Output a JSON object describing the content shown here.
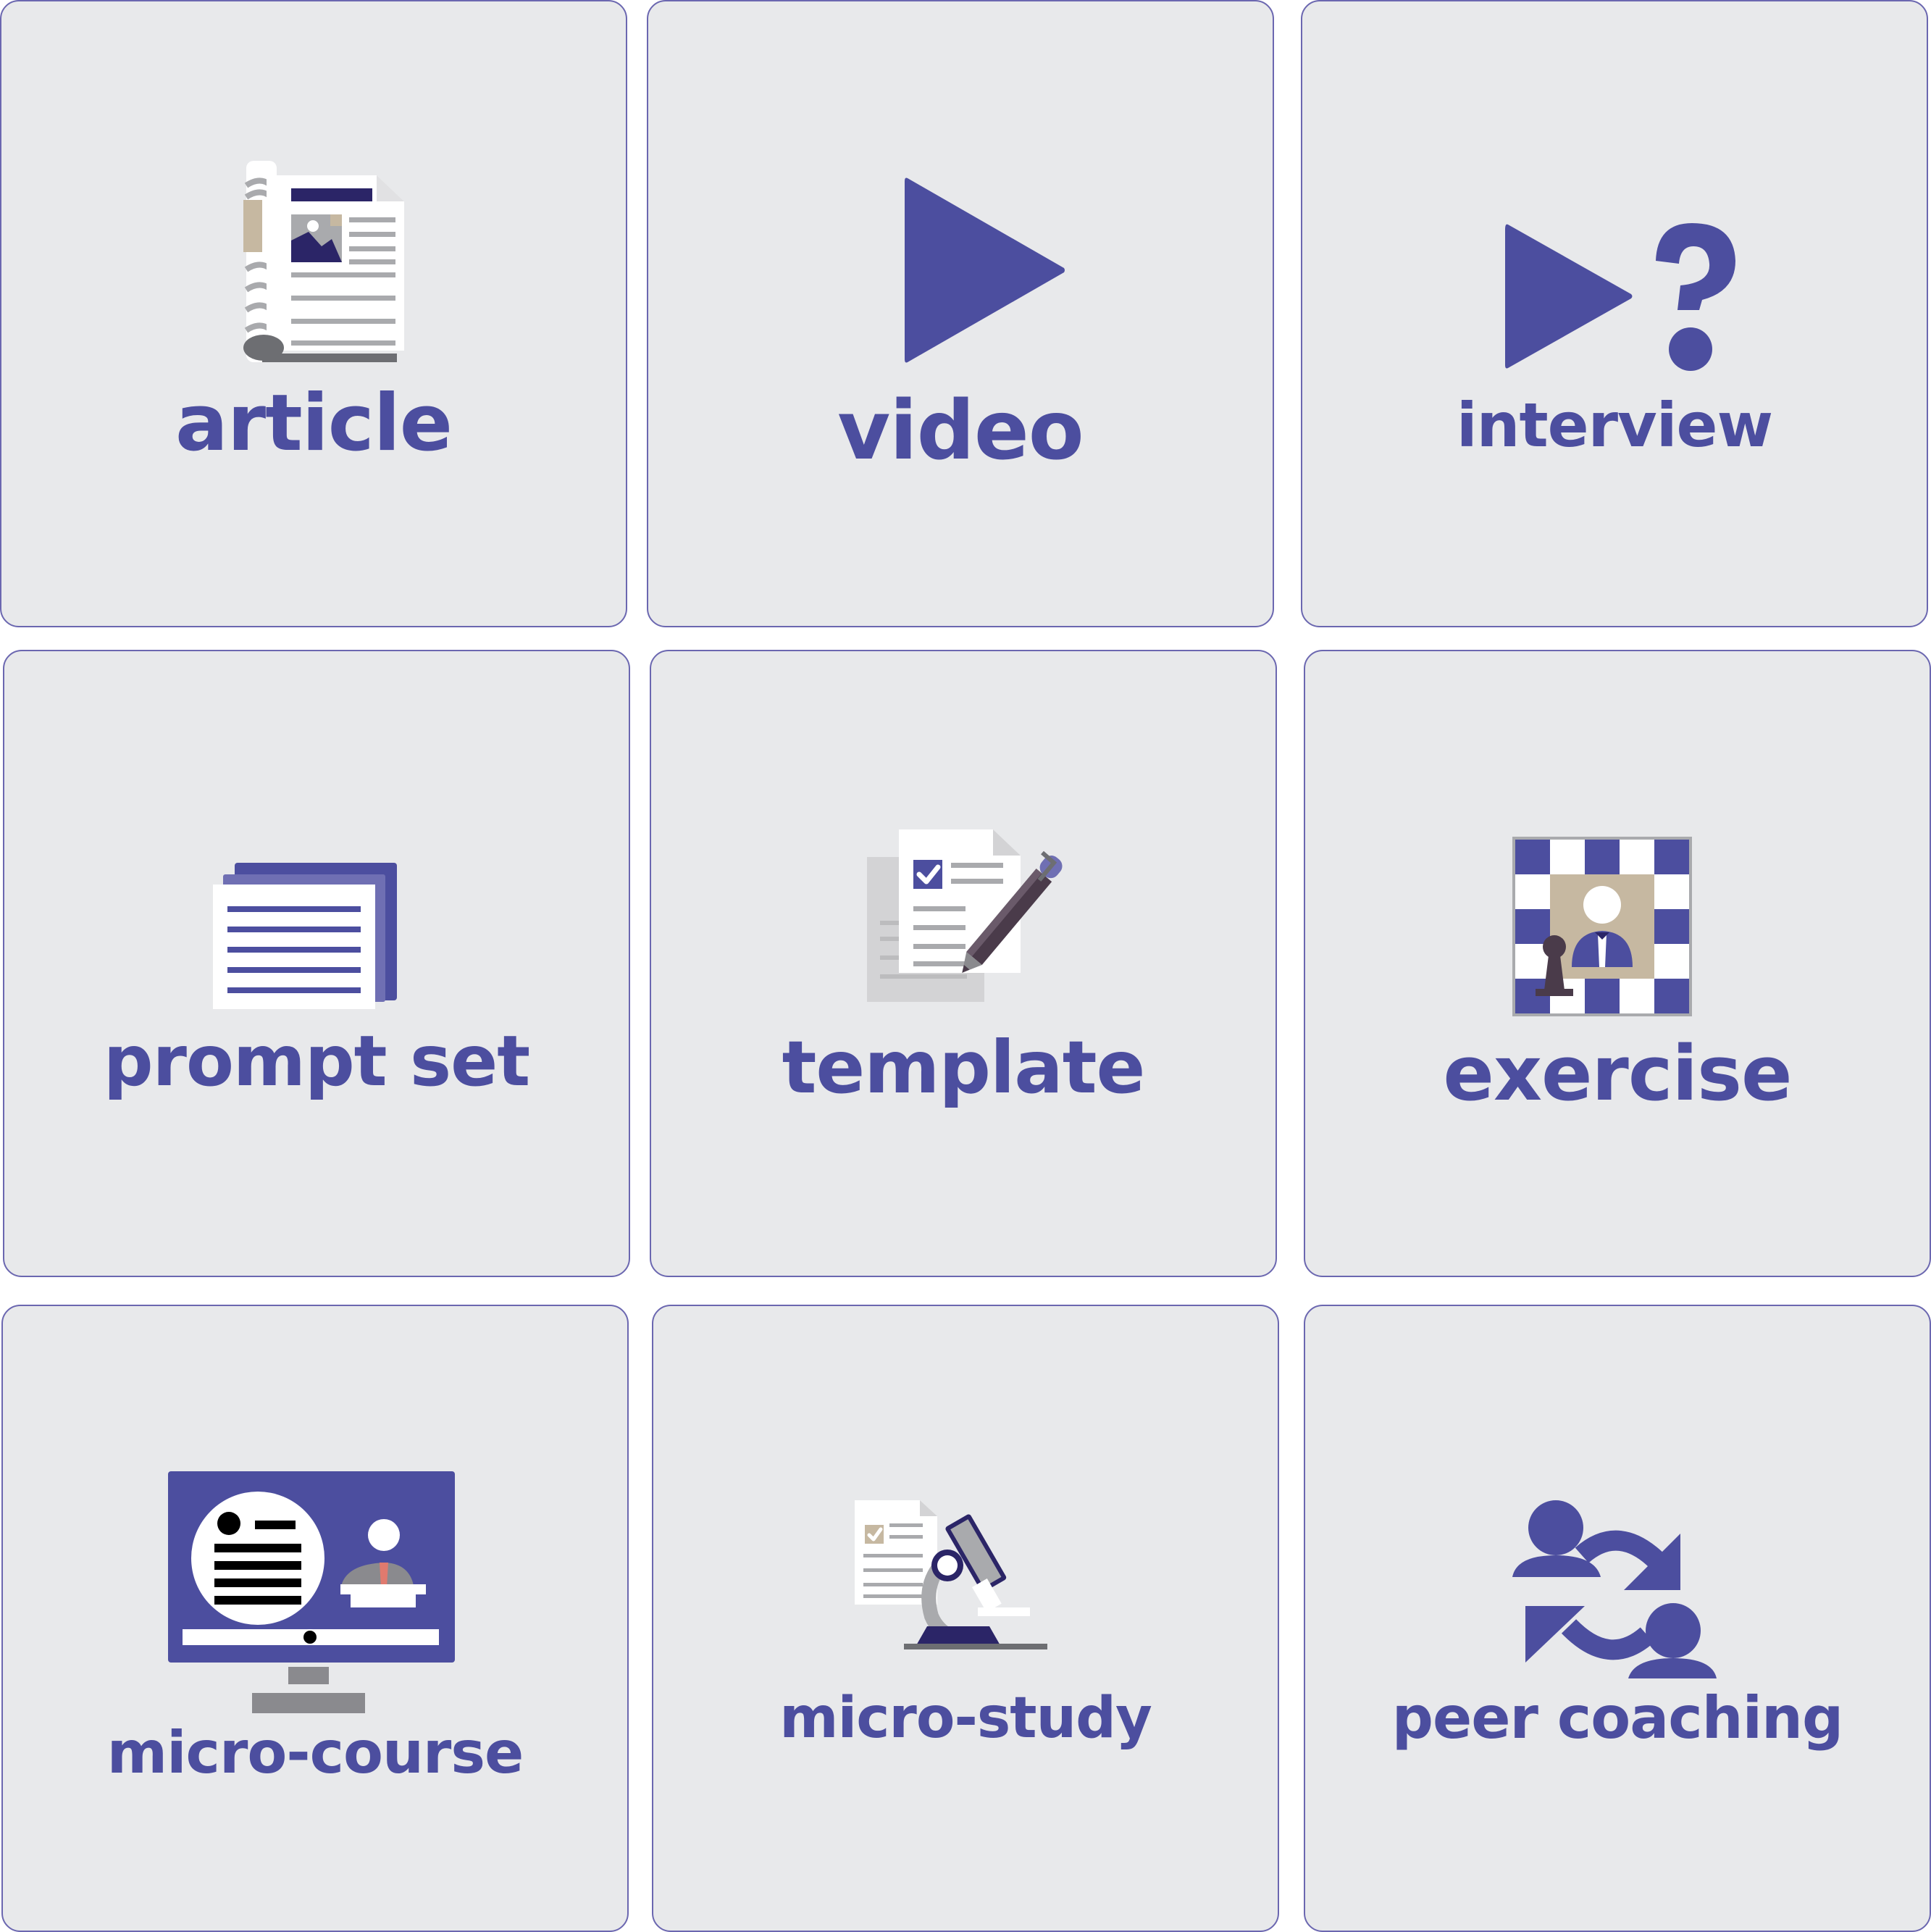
{
  "colors": {
    "tile_background": "#e8e9eb",
    "tile_border": "#6b67b0",
    "accent": "#4c4e9f",
    "dark_navy": "#2b2567",
    "gray": "#a9aaad",
    "tan": "#c6b8a1"
  },
  "tiles": [
    {
      "label": "article",
      "icon": "newspaper-icon"
    },
    {
      "label": "video",
      "icon": "play-icon"
    },
    {
      "label": "interview",
      "icon": "play-question-icon"
    },
    {
      "label": "prompt set",
      "icon": "stacked-pages-icon"
    },
    {
      "label": "template",
      "icon": "document-pencil-icon"
    },
    {
      "label": "exercise",
      "icon": "chessboard-person-icon"
    },
    {
      "label": "micro-course",
      "icon": "monitor-presentation-icon"
    },
    {
      "label": "micro-study",
      "icon": "microscope-document-icon"
    },
    {
      "label": "peer coaching",
      "icon": "people-exchange-icon"
    }
  ]
}
